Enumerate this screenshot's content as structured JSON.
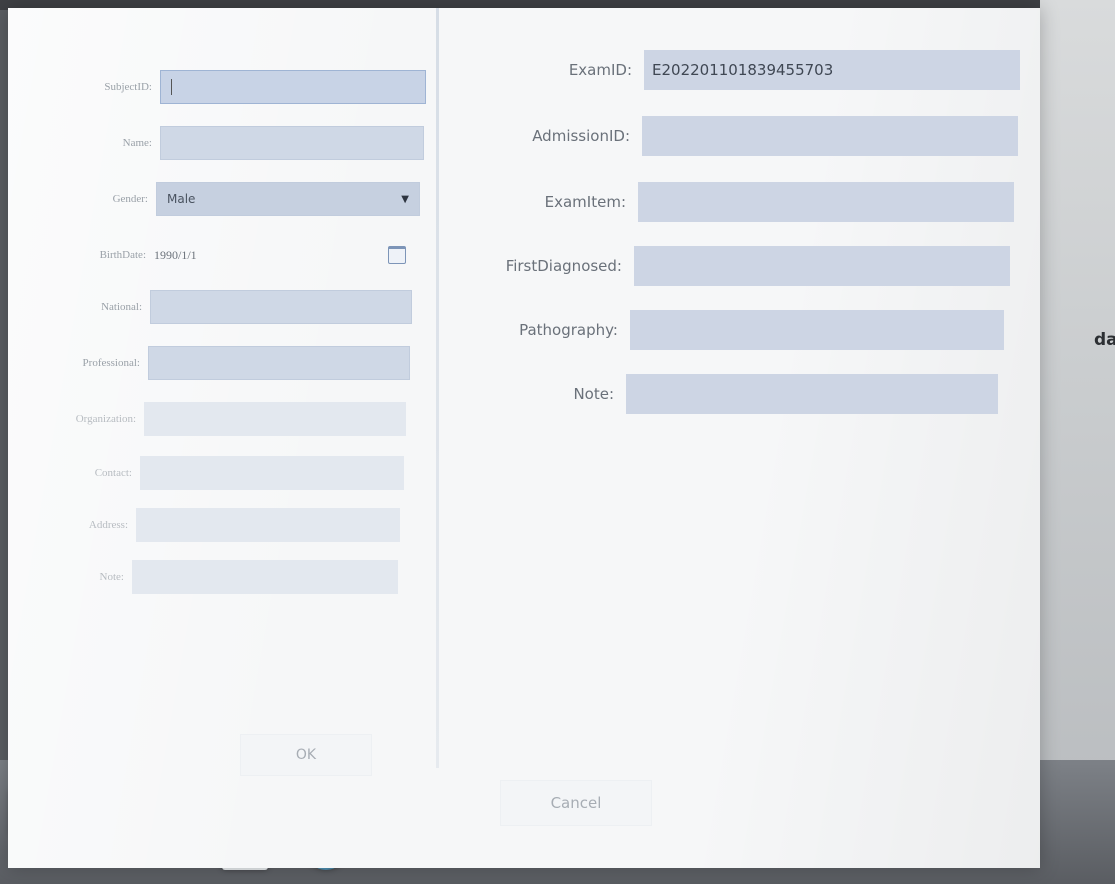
{
  "environment": {
    "desktop_text_fragment": "da"
  },
  "taskbar": {
    "icons": [
      {
        "name": "file-icon",
        "label": ""
      },
      {
        "name": "excel-icon",
        "label": ""
      },
      {
        "name": "document-icon",
        "label": ""
      },
      {
        "name": "pdf-icon",
        "label": ""
      },
      {
        "name": "globe-icon",
        "label": ""
      }
    ]
  },
  "left_form": {
    "subject_id": {
      "label": "SubjectID:",
      "value": ""
    },
    "name": {
      "label": "Name:",
      "value": ""
    },
    "gender": {
      "label": "Gender:",
      "value": "Male"
    },
    "birth_date": {
      "label": "BirthDate:",
      "value": "1990/1/1"
    },
    "national": {
      "label": "National:",
      "value": ""
    },
    "professional": {
      "label": "Professional:",
      "value": ""
    },
    "organization": {
      "label": "Organization:",
      "value": ""
    },
    "contact": {
      "label": "Contact:",
      "value": ""
    },
    "address": {
      "label": "Address:",
      "value": ""
    },
    "note": {
      "label": "Note:",
      "value": ""
    }
  },
  "right_form": {
    "exam_id": {
      "label": "ExamID:",
      "value": "E202201101839455703"
    },
    "admission_id": {
      "label": "AdmissionID:",
      "value": ""
    },
    "exam_item": {
      "label": "ExamItem:",
      "value": ""
    },
    "first_diagnosed": {
      "label": "FirstDiagnosed:",
      "value": ""
    },
    "pathography": {
      "label": "Pathography:",
      "value": ""
    },
    "note": {
      "label": "Note:",
      "value": ""
    }
  },
  "buttons": {
    "ok": "OK",
    "cancel": "Cancel"
  },
  "colors": {
    "field_bg": "#cfd8e6",
    "dialog_bg": "#f6f7f8"
  }
}
